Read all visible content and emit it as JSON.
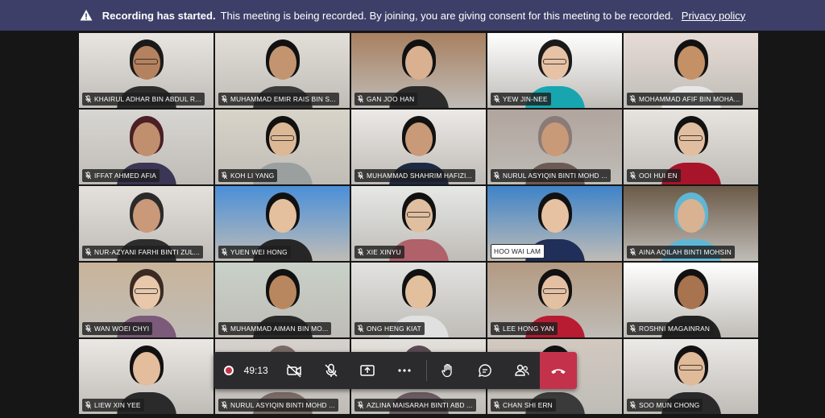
{
  "banner": {
    "title": "Recording has started.",
    "message": "This meeting is being recorded. By joining, you are giving consent for this meeting to be recorded.",
    "link": "Privacy policy"
  },
  "participants": [
    {
      "name": "KHAIRUL ADHAR BIN ABDUL R...",
      "muted": true,
      "bg": "#e9e6e2",
      "skin": "#b4825e",
      "shirt": "#2c2c2c",
      "hair": "#1a1a1a"
    },
    {
      "name": "MUHAMMAD EMIR RAIS BIN S...",
      "muted": true,
      "bg": "#e3ded8",
      "skin": "#c29470",
      "shirt": "#3a3a3a",
      "hair": "#111111"
    },
    {
      "name": "GAN JOO HAN",
      "muted": true,
      "bg": "#a88060",
      "skin": "#d9b090",
      "shirt": "#2b2b2b",
      "hair": "#111111"
    },
    {
      "name": "YEW JIN-NEE",
      "muted": true,
      "bg": "#ffffff",
      "skin": "#e7c2a4",
      "shirt": "#17a6b0",
      "hair": "#1a1a1a"
    },
    {
      "name": "MOHAMMAD AFIF BIN MOHA...",
      "muted": true,
      "bg": "#e7dcd5",
      "skin": "#c49066",
      "shirt": "#e6e6e6",
      "hair": "#111111"
    },
    {
      "name": "IFFAT AHMED AFIA",
      "muted": true,
      "bg": "#d8d6d2",
      "skin": "#c08f6e",
      "shirt": "#3b3556",
      "hair": "#4a1f25"
    },
    {
      "name": "KOH LI YANG",
      "muted": true,
      "bg": "#d9d4c8",
      "skin": "#dcb896",
      "shirt": "#9a9f9f",
      "hair": "#111111"
    },
    {
      "name": "MUHAMMAD SHAHRIM HAFIZI...",
      "muted": true,
      "bg": "#ece9e6",
      "skin": "#c89a78",
      "shirt": "#1d2a44",
      "hair": "#111111"
    },
    {
      "name": "NURUL ASYIQIN BINTI MOHD ...",
      "muted": true,
      "bg": "#b1a59d",
      "skin": "#c89a78",
      "shirt": "#6c5a55",
      "hair": "#8b7b78"
    },
    {
      "name": "OOI HUI EN",
      "muted": true,
      "bg": "#e7e4df",
      "skin": "#e2bea0",
      "shirt": "#a8142a",
      "hair": "#111111"
    },
    {
      "name": "NUR-AZYANI FARHI BINTI ZUL...",
      "muted": true,
      "bg": "#e4e0db",
      "skin": "#c9997a",
      "shirt": "#2d2d2d",
      "hair": "#2a2a2a"
    },
    {
      "name": "YUEN WEI HONG",
      "muted": true,
      "bg": "#4a8fd8",
      "skin": "#e4c09e",
      "shirt": "#262626",
      "hair": "#111111"
    },
    {
      "name": "XIE XINYU",
      "muted": true,
      "bg": "#e6e8e6",
      "skin": "#e0bea0",
      "shirt": "#b0616a",
      "hair": "#111111"
    },
    {
      "name": "HOO WAI LAM",
      "muted": false,
      "bg": "#3e83c8",
      "skin": "#e6c2a3",
      "shirt": "#1f2f5a",
      "hair": "#111111"
    },
    {
      "name": "AINA AQILAH BINTI MOHSIN",
      "muted": true,
      "bg": "#6b5a48",
      "skin": "#d9b291",
      "shirt": "#5fb7d5",
      "hair": "#5fb7d5"
    },
    {
      "name": "WAN WOEI CHYI",
      "muted": true,
      "bg": "#c9b49a",
      "skin": "#e8c7ab",
      "shirt": "#7b5a7a",
      "hair": "#3a2a22"
    },
    {
      "name": "MUHAMMAD AIMAN BIN  MO...",
      "muted": true,
      "bg": "#c8d1c8",
      "skin": "#b9875f",
      "shirt": "#2a2a2a",
      "hair": "#111111"
    },
    {
      "name": "ONG HENG KIAT",
      "muted": true,
      "bg": "#e2e2e0",
      "skin": "#e2c09e",
      "shirt": "#e0e0e0",
      "hair": "#111111"
    },
    {
      "name": "LEE HONG YAN",
      "muted": true,
      "bg": "#b39a82",
      "skin": "#e4c0a2",
      "shirt": "#b81c33",
      "hair": "#111111"
    },
    {
      "name": "ROSHNI MAGAINRAN",
      "muted": true,
      "bg": "#ffffff",
      "skin": "#a8734f",
      "shirt": "#222222",
      "hair": "#111111"
    },
    {
      "name": "LIEW XIN YEE",
      "muted": true,
      "bg": "#ebe8e4",
      "skin": "#e3bd9c",
      "shirt": "#2a2a2a",
      "hair": "#111111"
    },
    {
      "name": "NURUL ASYIQIN BINTI MOHD ...",
      "muted": true,
      "bg": "#d6d1cc",
      "skin": "#c9997a",
      "shirt": "#7a6a66",
      "hair": "#7a6a66"
    },
    {
      "name": "AZLINA MAISARAH BINTI ABD ...",
      "muted": true,
      "bg": "#e4e1dc",
      "skin": "#c9997a",
      "shirt": "#6a5a62",
      "hair": "#5a4a52"
    },
    {
      "name": "CHAN SHI ERN",
      "muted": true,
      "bg": "#d2c9c0",
      "skin": "#e2bea0",
      "shirt": "#3a3a3a",
      "hair": "#111111"
    },
    {
      "name": "SOO MUN CHONG",
      "muted": true,
      "bg": "#eceae7",
      "skin": "#e0bb99",
      "shirt": "#2a2a2a",
      "hair": "#111111"
    }
  ],
  "controls": {
    "timer": "49:13",
    "recording_color": "#c4314b"
  },
  "colors": {
    "banner": "#3d3f68",
    "hangup": "#c4314b"
  }
}
